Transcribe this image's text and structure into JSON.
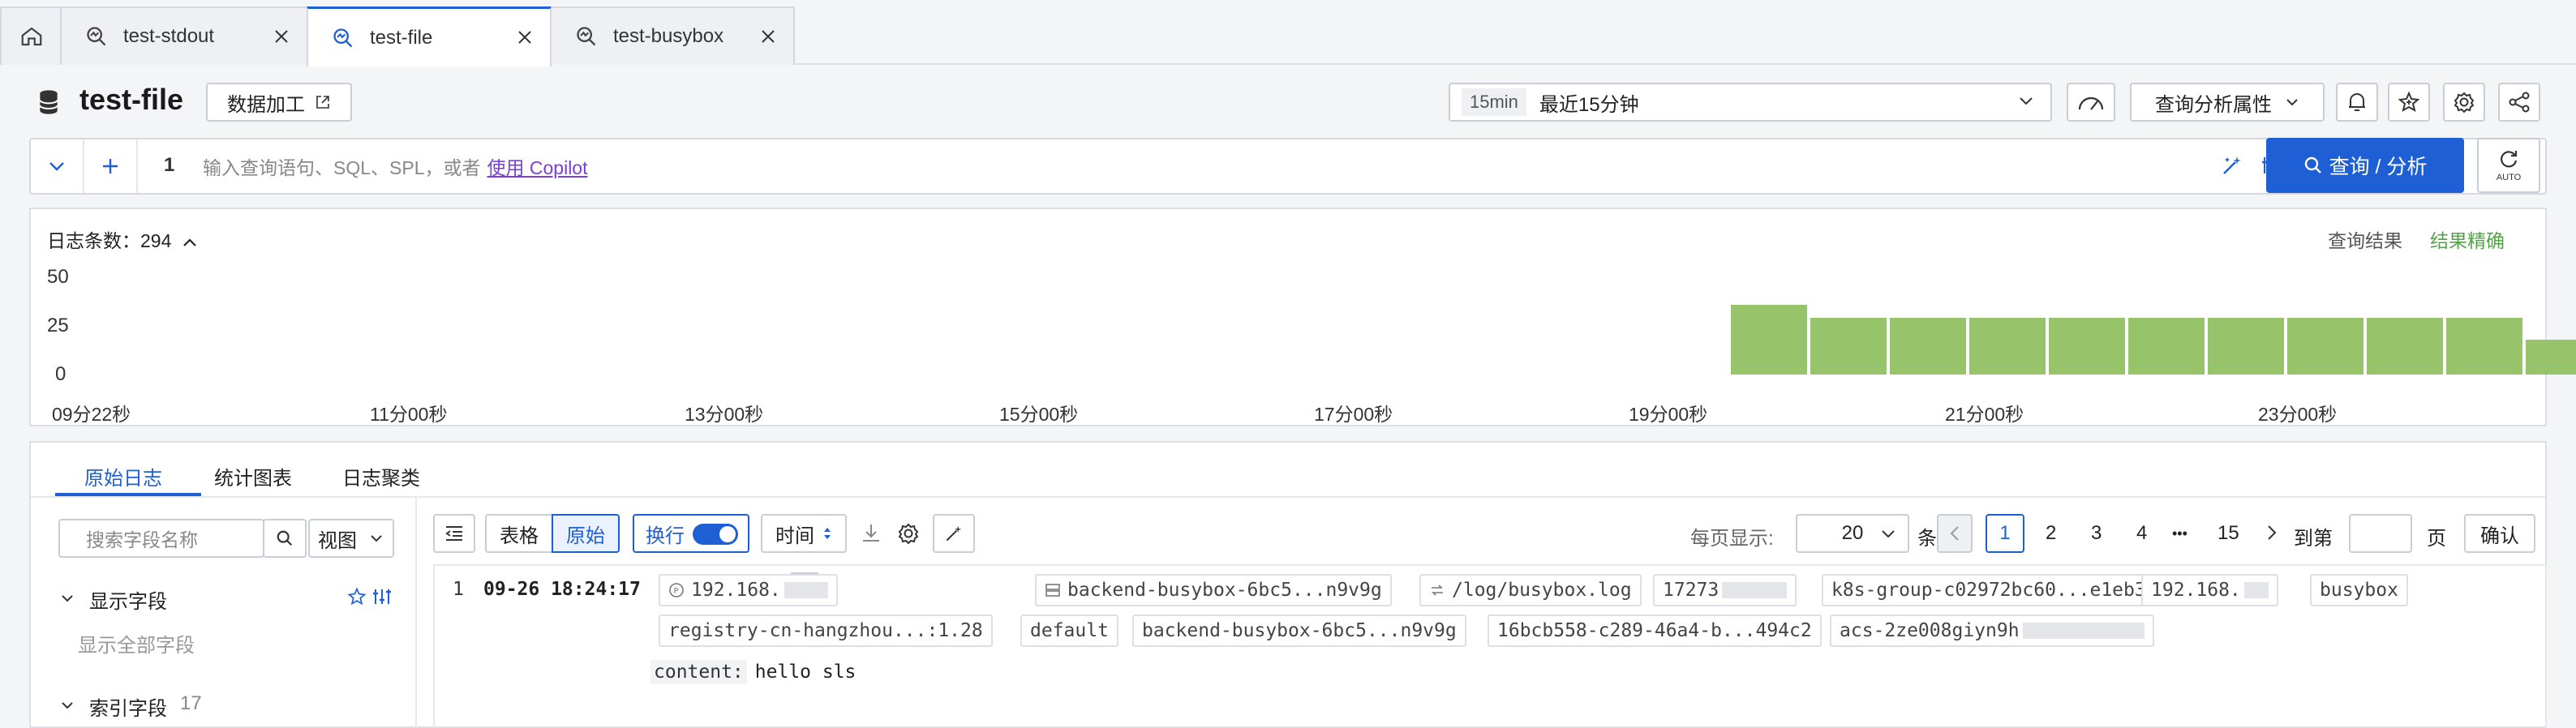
{
  "tabs": [
    {
      "label": ""
    },
    {
      "label": "test-stdout"
    },
    {
      "label": "test-file"
    },
    {
      "label": "test-busybox"
    }
  ],
  "header": {
    "title": "test-file",
    "data_process_label": "数据加工",
    "time_tag": "15min",
    "time_label": "最近15分钟",
    "analysis_props_label": "查询分析属性"
  },
  "query": {
    "line_number": "1",
    "placeholder": "输入查询语句、SQL、SPL，或者",
    "copilot_link": "使用 Copilot",
    "search_label": "查询 / 分析",
    "auto_label": "AUTO"
  },
  "histogram": {
    "count_label": "日志条数：",
    "count_value": "294",
    "result_label": "查询结果",
    "precision_label": "结果精确",
    "precision_color": "#52a447"
  },
  "chart_data": {
    "type": "bar",
    "ylim": [
      0,
      50
    ],
    "yticks": [
      "50",
      "25",
      "0"
    ],
    "xticks": [
      "09分22秒",
      "11分00秒",
      "13分00秒",
      "15分00秒",
      "17分00秒",
      "19分00秒",
      "21分00秒",
      "23分00秒"
    ],
    "values": [
      36,
      29,
      29,
      29,
      29,
      29,
      29,
      29,
      29,
      29,
      18
    ],
    "color": "#97c46b"
  },
  "results": {
    "tabs": [
      "原始日志",
      "统计图表",
      "日志聚类"
    ],
    "field_search_placeholder": "搜索字段名称",
    "view_label": "视图",
    "display_fields_label": "显示字段",
    "show_all_label": "显示全部字段",
    "index_fields_label": "索引字段",
    "index_fields_count": "17",
    "table_btn": "表格",
    "raw_btn": "原始",
    "wrap_label": "换行",
    "time_label": "时间",
    "per_page_label": "每页显示:",
    "per_page_value": "20",
    "unit_label": "条",
    "pages": [
      "1",
      "2",
      "3",
      "4",
      "•••",
      "15"
    ],
    "goto_label": "到第",
    "page_unit": "页",
    "confirm_label": "确认"
  },
  "log": {
    "index": "1",
    "time": "09-26 18:24:17",
    "chips_row1": [
      "192.168.",
      "backend-busybox-6bc5...n9v9g",
      "/log/busybox.log",
      "17273",
      "k8s-group-c02972bc60...e1eb3",
      "192.168.",
      "busybox"
    ],
    "chips_row2": [
      "registry-cn-hangzhou...:1.28",
      "default",
      "backend-busybox-6bc5...n9v9g",
      "16bcb558-c289-46a4-b...494c2",
      "acs-2ze008giyn9h"
    ],
    "content_key": "content:",
    "content_value": "hello sls"
  }
}
